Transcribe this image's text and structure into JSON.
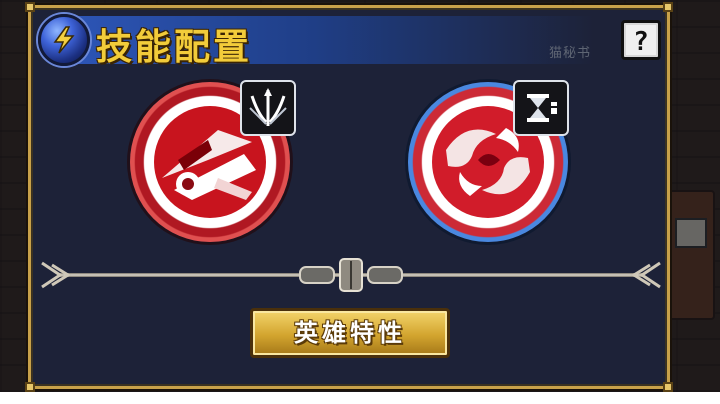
{
  "panel": {
    "title": "技能配置",
    "help_label": "?",
    "background_npc_label": "猫秘书"
  },
  "skills": [
    {
      "name": "",
      "ring_color": "#c21a26",
      "icon": "slash-skill-icon",
      "badge_icon": "spear-trident-icon"
    },
    {
      "name": "",
      "ring_color": "#2f6bd0",
      "icon": "blood-swirl-skill-icon",
      "badge_icon": "hourglass-sword-icon"
    }
  ],
  "buttons": {
    "hero_traits": "英雄特性"
  },
  "colors": {
    "title_gold": "#f2cc3a",
    "panel_bg": "#1d2238",
    "frame_gold": "#c8a14a",
    "title_bar_blue": "#2d56b8"
  }
}
